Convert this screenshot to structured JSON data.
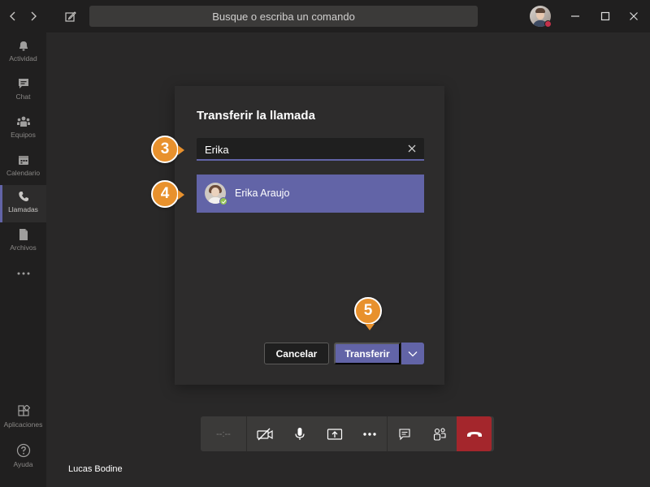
{
  "titlebar": {
    "search_placeholder": "Busque o escriba un comando",
    "icons": [
      "chevron-left-icon",
      "chevron-right-icon",
      "compose-icon",
      "minimize-icon",
      "maximize-icon",
      "close-icon"
    ]
  },
  "rail": {
    "items": [
      {
        "label": "Actividad",
        "icon": "bell-icon"
      },
      {
        "label": "Chat",
        "icon": "chat-icon"
      },
      {
        "label": "Equipos",
        "icon": "teams-icon"
      },
      {
        "label": "Calendario",
        "icon": "calendar-icon"
      },
      {
        "label": "Llamadas",
        "icon": "phone-icon",
        "active": true
      },
      {
        "label": "Archivos",
        "icon": "file-icon"
      }
    ],
    "bottom": [
      {
        "label": "Aplicaciones",
        "icon": "apps-icon"
      },
      {
        "label": "Ayuda",
        "icon": "help-icon"
      }
    ]
  },
  "dialog": {
    "title": "Transferir la llamada",
    "search_value": "Erika",
    "result_name": "Erika Araujo",
    "cancel_label": "Cancelar",
    "transfer_label": "Transferir"
  },
  "callouts": {
    "step3": "3",
    "step4": "4",
    "step5": "5"
  },
  "call": {
    "timer": "--:--",
    "self_name": "Lucas Bodine"
  },
  "colors": {
    "accent": "#6264a7",
    "callout": "#e8912d",
    "end_call": "#a4262c",
    "busy": "#c4314b",
    "available": "#92c353"
  }
}
